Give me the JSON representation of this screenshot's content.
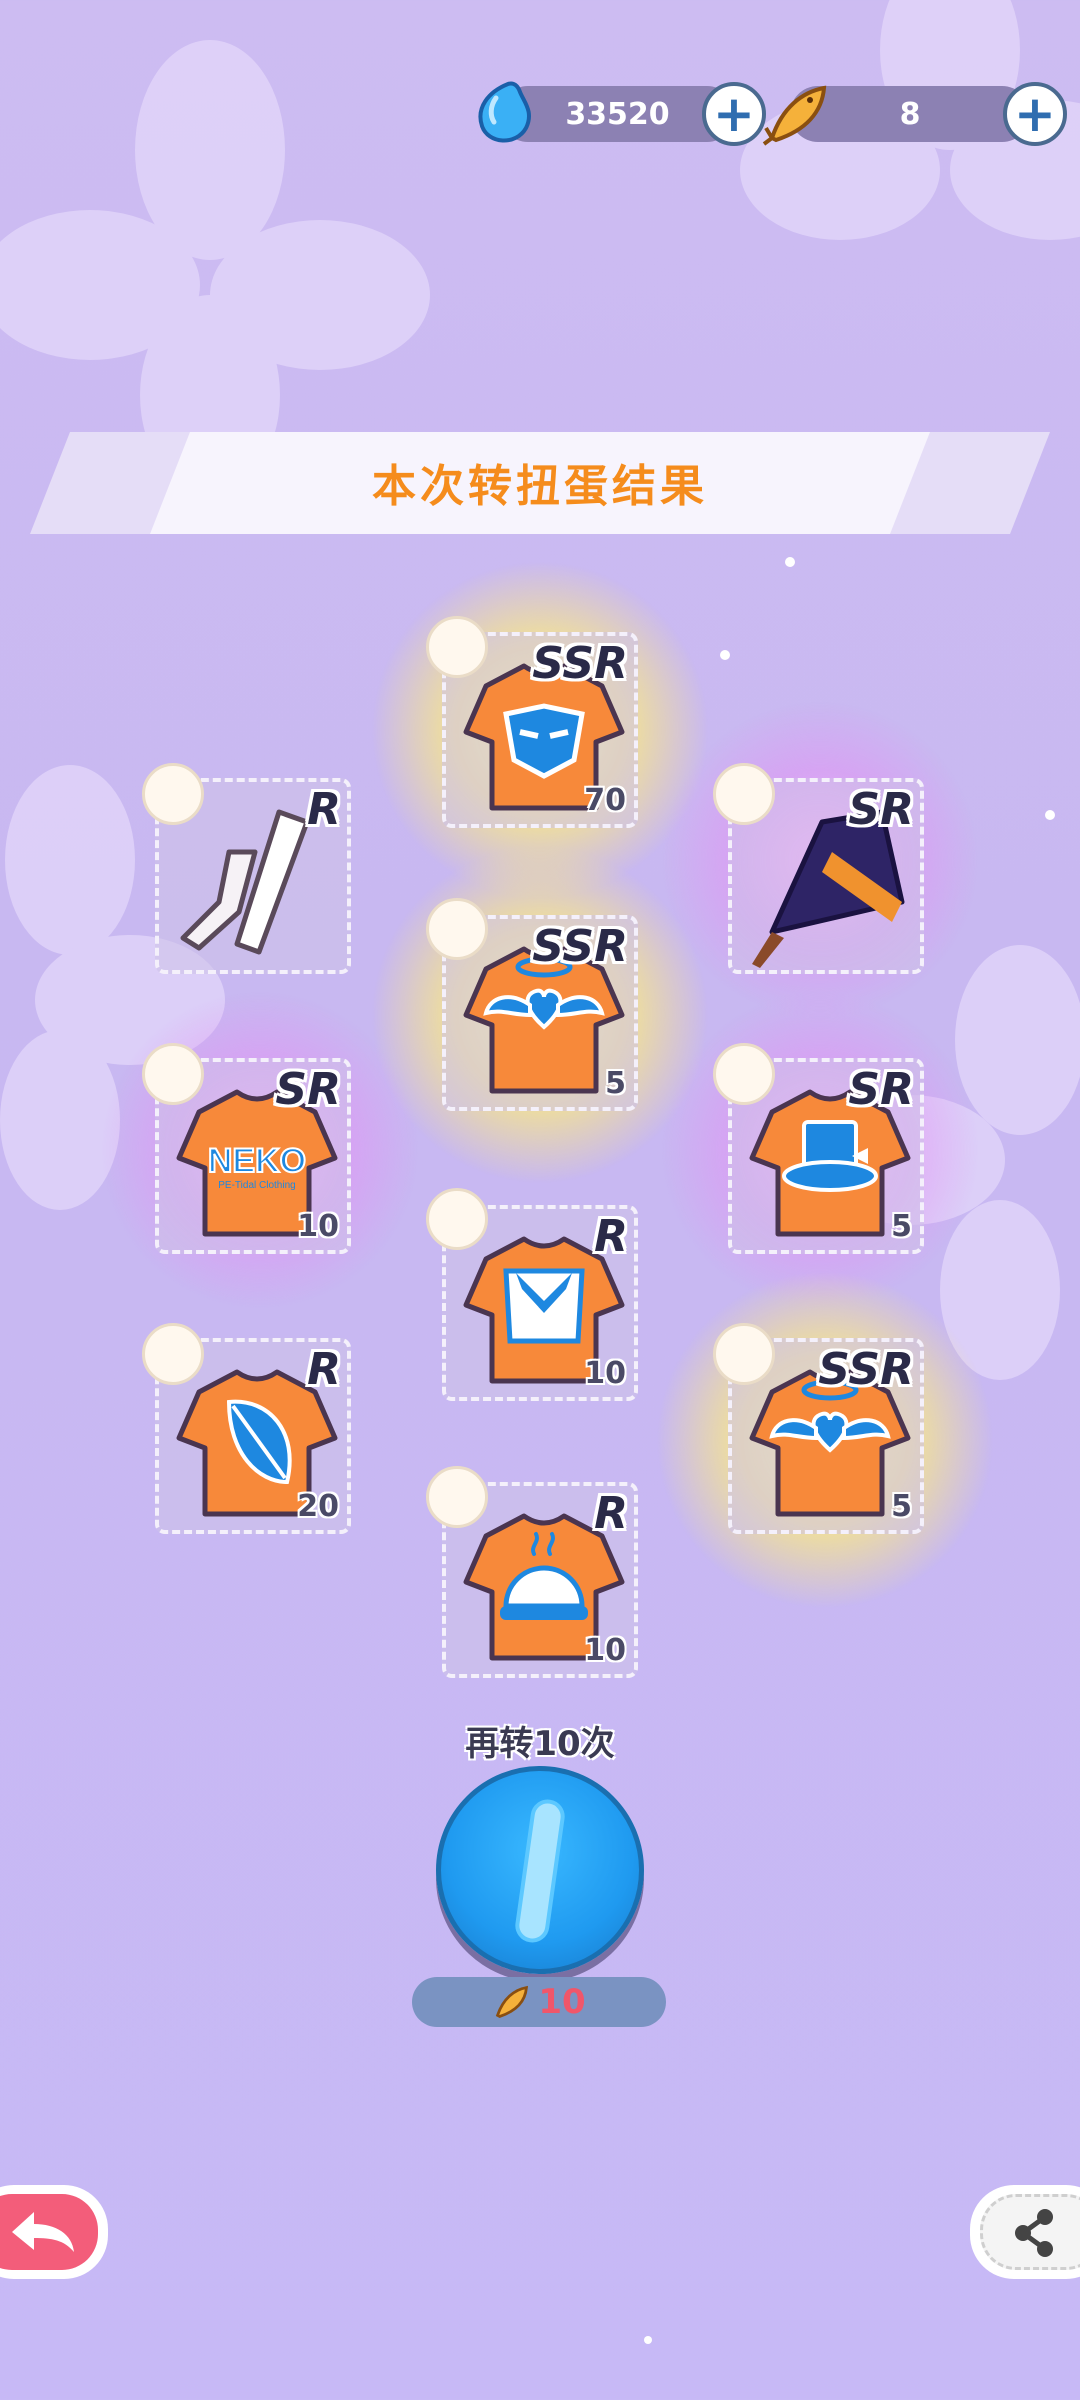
{
  "currency": {
    "gems": "33520",
    "fish": "8"
  },
  "banner": {
    "title": "本次转扭蛋结果"
  },
  "items": [
    {
      "rarity": "SSR",
      "qty": "70",
      "kind": "mask-shirt"
    },
    {
      "rarity": "R",
      "qty": "",
      "kind": "stockings"
    },
    {
      "rarity": "SR",
      "qty": "",
      "kind": "witch-hat"
    },
    {
      "rarity": "SSR",
      "qty": "5",
      "kind": "wings-heart-shirt"
    },
    {
      "rarity": "SR",
      "qty": "10",
      "kind": "neko-shirt"
    },
    {
      "rarity": "SR",
      "qty": "5",
      "kind": "tophat-shirt"
    },
    {
      "rarity": "R",
      "qty": "10",
      "kind": "sailor-shirt"
    },
    {
      "rarity": "R",
      "qty": "20",
      "kind": "leaf-shirt"
    },
    {
      "rarity": "SSR",
      "qty": "5",
      "kind": "wings-heart-shirt"
    },
    {
      "rarity": "R",
      "qty": "10",
      "kind": "dish-shirt"
    }
  ],
  "neko_logo": "NEKO",
  "neko_sub": "PE-Tidal Clothing",
  "spin": {
    "label": "再转10次",
    "cost": "10"
  },
  "colors": {
    "accent_orange": "#f58c1c",
    "shirt_orange": "#f7893a",
    "print_blue": "#1e88e0",
    "spin_blue": "#1f9af0",
    "cost_red": "#f0566a"
  }
}
